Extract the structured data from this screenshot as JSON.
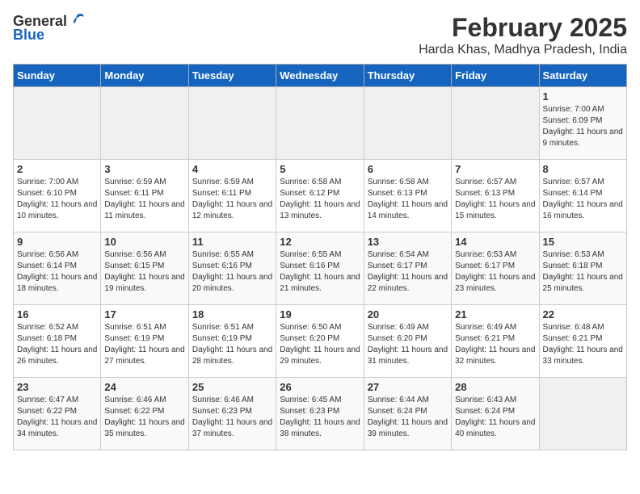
{
  "logo": {
    "general": "General",
    "blue": "Blue"
  },
  "title": "February 2025",
  "subtitle": "Harda Khas, Madhya Pradesh, India",
  "days_of_week": [
    "Sunday",
    "Monday",
    "Tuesday",
    "Wednesday",
    "Thursday",
    "Friday",
    "Saturday"
  ],
  "weeks": [
    [
      {
        "day": "",
        "info": ""
      },
      {
        "day": "",
        "info": ""
      },
      {
        "day": "",
        "info": ""
      },
      {
        "day": "",
        "info": ""
      },
      {
        "day": "",
        "info": ""
      },
      {
        "day": "",
        "info": ""
      },
      {
        "day": "1",
        "info": "Sunrise: 7:00 AM\nSunset: 6:09 PM\nDaylight: 11 hours\nand 9 minutes."
      }
    ],
    [
      {
        "day": "2",
        "info": "Sunrise: 7:00 AM\nSunset: 6:10 PM\nDaylight: 11 hours\nand 10 minutes."
      },
      {
        "day": "3",
        "info": "Sunrise: 6:59 AM\nSunset: 6:11 PM\nDaylight: 11 hours\nand 11 minutes."
      },
      {
        "day": "4",
        "info": "Sunrise: 6:59 AM\nSunset: 6:11 PM\nDaylight: 11 hours\nand 12 minutes."
      },
      {
        "day": "5",
        "info": "Sunrise: 6:58 AM\nSunset: 6:12 PM\nDaylight: 11 hours\nand 13 minutes."
      },
      {
        "day": "6",
        "info": "Sunrise: 6:58 AM\nSunset: 6:13 PM\nDaylight: 11 hours\nand 14 minutes."
      },
      {
        "day": "7",
        "info": "Sunrise: 6:57 AM\nSunset: 6:13 PM\nDaylight: 11 hours\nand 15 minutes."
      },
      {
        "day": "8",
        "info": "Sunrise: 6:57 AM\nSunset: 6:14 PM\nDaylight: 11 hours\nand 16 minutes."
      }
    ],
    [
      {
        "day": "9",
        "info": "Sunrise: 6:56 AM\nSunset: 6:14 PM\nDaylight: 11 hours\nand 18 minutes."
      },
      {
        "day": "10",
        "info": "Sunrise: 6:56 AM\nSunset: 6:15 PM\nDaylight: 11 hours\nand 19 minutes."
      },
      {
        "day": "11",
        "info": "Sunrise: 6:55 AM\nSunset: 6:16 PM\nDaylight: 11 hours\nand 20 minutes."
      },
      {
        "day": "12",
        "info": "Sunrise: 6:55 AM\nSunset: 6:16 PM\nDaylight: 11 hours\nand 21 minutes."
      },
      {
        "day": "13",
        "info": "Sunrise: 6:54 AM\nSunset: 6:17 PM\nDaylight: 11 hours\nand 22 minutes."
      },
      {
        "day": "14",
        "info": "Sunrise: 6:53 AM\nSunset: 6:17 PM\nDaylight: 11 hours\nand 23 minutes."
      },
      {
        "day": "15",
        "info": "Sunrise: 6:53 AM\nSunset: 6:18 PM\nDaylight: 11 hours\nand 25 minutes."
      }
    ],
    [
      {
        "day": "16",
        "info": "Sunrise: 6:52 AM\nSunset: 6:18 PM\nDaylight: 11 hours\nand 26 minutes."
      },
      {
        "day": "17",
        "info": "Sunrise: 6:51 AM\nSunset: 6:19 PM\nDaylight: 11 hours\nand 27 minutes."
      },
      {
        "day": "18",
        "info": "Sunrise: 6:51 AM\nSunset: 6:19 PM\nDaylight: 11 hours\nand 28 minutes."
      },
      {
        "day": "19",
        "info": "Sunrise: 6:50 AM\nSunset: 6:20 PM\nDaylight: 11 hours\nand 29 minutes."
      },
      {
        "day": "20",
        "info": "Sunrise: 6:49 AM\nSunset: 6:20 PM\nDaylight: 11 hours\nand 31 minutes."
      },
      {
        "day": "21",
        "info": "Sunrise: 6:49 AM\nSunset: 6:21 PM\nDaylight: 11 hours\nand 32 minutes."
      },
      {
        "day": "22",
        "info": "Sunrise: 6:48 AM\nSunset: 6:21 PM\nDaylight: 11 hours\nand 33 minutes."
      }
    ],
    [
      {
        "day": "23",
        "info": "Sunrise: 6:47 AM\nSunset: 6:22 PM\nDaylight: 11 hours\nand 34 minutes."
      },
      {
        "day": "24",
        "info": "Sunrise: 6:46 AM\nSunset: 6:22 PM\nDaylight: 11 hours\nand 35 minutes."
      },
      {
        "day": "25",
        "info": "Sunrise: 6:46 AM\nSunset: 6:23 PM\nDaylight: 11 hours\nand 37 minutes."
      },
      {
        "day": "26",
        "info": "Sunrise: 6:45 AM\nSunset: 6:23 PM\nDaylight: 11 hours\nand 38 minutes."
      },
      {
        "day": "27",
        "info": "Sunrise: 6:44 AM\nSunset: 6:24 PM\nDaylight: 11 hours\nand 39 minutes."
      },
      {
        "day": "28",
        "info": "Sunrise: 6:43 AM\nSunset: 6:24 PM\nDaylight: 11 hours\nand 40 minutes."
      },
      {
        "day": "",
        "info": ""
      }
    ]
  ]
}
